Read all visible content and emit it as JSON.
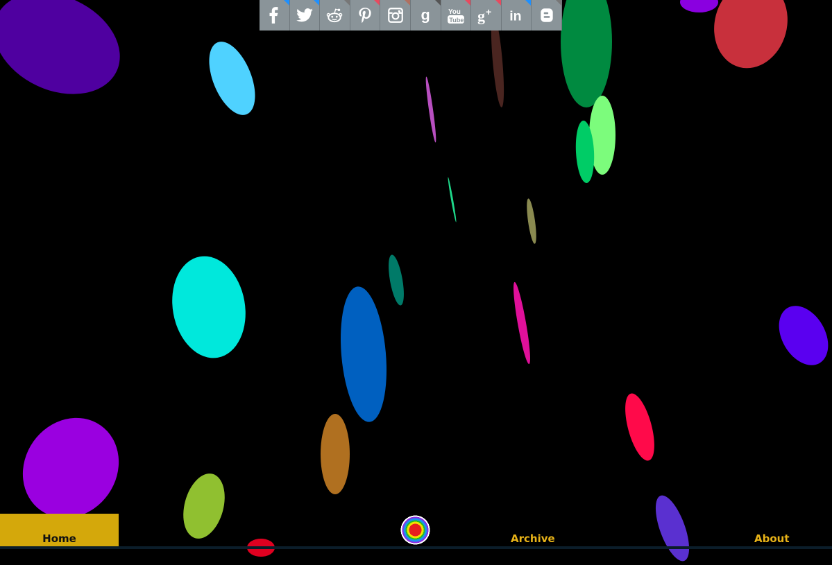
{
  "social": [
    {
      "name": "facebook",
      "glyph": "f",
      "corner": "#1e90ff"
    },
    {
      "name": "twitter",
      "glyph": "",
      "corner": "#1e90ff"
    },
    {
      "name": "reddit",
      "glyph": "",
      "corner": "#777777"
    },
    {
      "name": "pinterest",
      "glyph": "",
      "corner": "#e84a5f"
    },
    {
      "name": "instagram",
      "glyph": "",
      "corner": "#b07060"
    },
    {
      "name": "goodreads",
      "glyph": "g",
      "corner": "#555555"
    },
    {
      "name": "youtube",
      "glyph": "",
      "corner": "#e84a5f"
    },
    {
      "name": "googleplus",
      "glyph": "g+",
      "corner": "#e84a5f"
    },
    {
      "name": "linkedin",
      "glyph": "in",
      "corner": "#1e90ff"
    },
    {
      "name": "blogger",
      "glyph": "B",
      "corner": "#777777"
    }
  ],
  "nav": {
    "home": "Home",
    "archive": "Archive",
    "about": "About"
  },
  "colors": {
    "background": "#000000",
    "nav_accent": "#d4a80b",
    "nav_text": "#e8b318",
    "social_bg": "#8a9499"
  }
}
